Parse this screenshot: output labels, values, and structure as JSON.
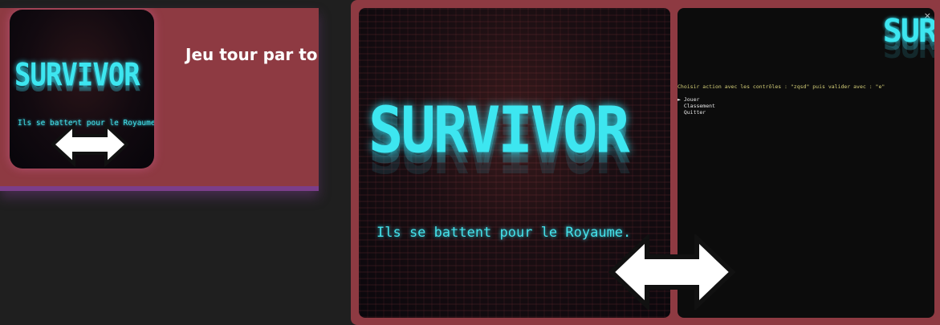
{
  "card": {
    "title": "Jeu tour par to",
    "thumbnail": {
      "logo": "SURVIVOR",
      "tagline": "Ils se battent pour le Royaume"
    }
  },
  "preview": {
    "logo": "SURVIVOR",
    "tagline": "Ils se battent pour le Royaume."
  },
  "console": {
    "logo": "SUR",
    "prompt": "Choisir action avec les contrôles : \"zqsd\" puis valider avec : \"e\"",
    "menu": [
      {
        "label": "► Jouer",
        "selected": true
      },
      {
        "label": "  Classement",
        "selected": false
      },
      {
        "label": "  Quitter",
        "selected": false
      }
    ],
    "close_label": "×"
  },
  "colors": {
    "accent": "#8e3a42",
    "neon": "#3de6f0",
    "background": "#1f1f1f",
    "prompt": "#d8d27a"
  },
  "icons": [
    "double-arrow-icon",
    "close-icon"
  ]
}
